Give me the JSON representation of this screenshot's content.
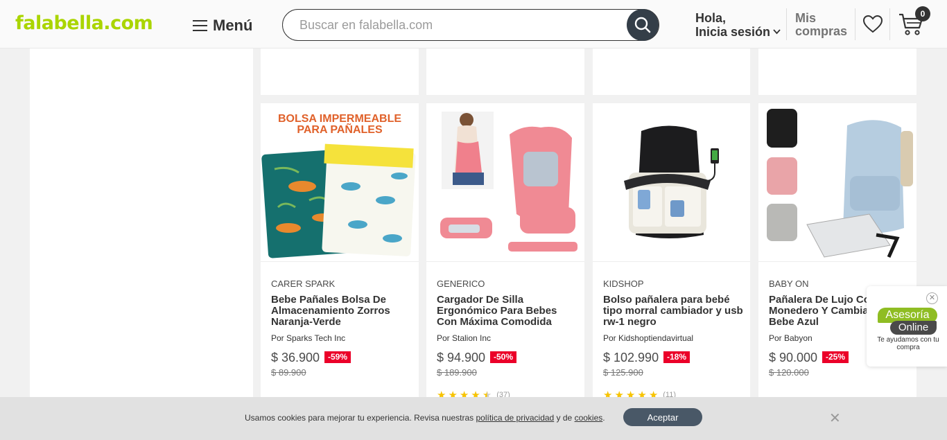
{
  "header": {
    "logo": "falabella.com",
    "menu_label": "Menú",
    "search_placeholder": "Buscar en falabella.com",
    "account_line1": "Hola,",
    "account_line2": "Inicia sesión",
    "purchases_line1": "Mis",
    "purchases_line2": "compras",
    "cart_count": "0"
  },
  "products": [
    {
      "brand": "CARER SPARK",
      "title": "Bebe Pañales Bolsa De Almacenamiento Zorros Naranja-Verde",
      "seller": "Por Sparks Tech Inc",
      "price": "$ 36.900",
      "discount": "-59%",
      "old_price": "$ 89.900",
      "image_caption_line1": "BOLSA IMPERMEABLE",
      "image_caption_line2": "PARA PAÑALES"
    },
    {
      "brand": "GENERICO",
      "title": "Cargador De Silla Ergonómico Para Bebes Con Máxima Comodida",
      "seller": "Por Stalion Inc",
      "price": "$ 94.900",
      "discount": "-50%",
      "old_price": "$ 189.900",
      "rating_count": "(37)",
      "rating": 4.5
    },
    {
      "brand": "KIDSHOP",
      "title": "Bolso pañalera para bebé tipo morral cambiador y usb rw-1 negro",
      "seller": "Por Kidshoptiendavirtual",
      "price": "$ 102.990",
      "discount": "-18%",
      "old_price": "$ 125.900",
      "rating_count": "(11)",
      "rating": 5
    },
    {
      "brand": "BABY ON",
      "title": "Pañalera De Lujo Con Monedero Y Cambiador Para Bebe Azul",
      "seller": "Por Babyon",
      "price": "$ 90.000",
      "discount": "-25%",
      "old_price": "$ 120.000"
    }
  ],
  "chat": {
    "line1": "Asesoría",
    "line2": "Online",
    "subtitle": "Te ayudamos con tu compra"
  },
  "cookie": {
    "text_before": "Usamos cookies para mejorar tu experiencia. Revisa nuestras ",
    "privacy_link": "política de privacidad",
    "text_middle": " y de ",
    "cookies_link": "cookies",
    "text_end": ".",
    "accept_label": "Aceptar"
  },
  "colors": {
    "brand_green": "#aad500",
    "discount_red": "#eb0029",
    "star_yellow": "#f7c300"
  }
}
